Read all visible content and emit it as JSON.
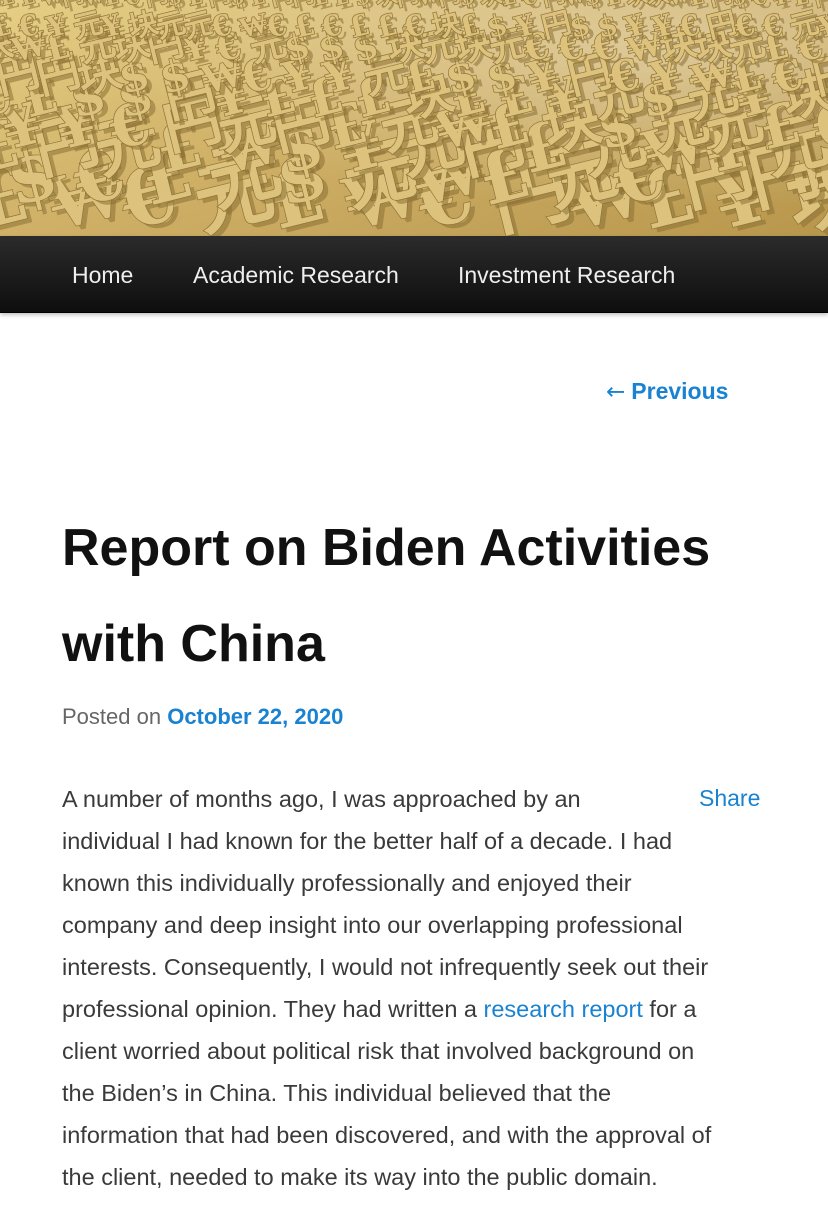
{
  "header": {
    "banner_icon": "currency-symbols-banner",
    "glyphs": [
      "€",
      "元",
      "¥",
      "£",
      "₩",
      "$",
      "块",
      "円"
    ]
  },
  "nav": {
    "items": [
      {
        "label": "Home"
      },
      {
        "label": "Academic Research"
      },
      {
        "label": "Investment Research"
      }
    ]
  },
  "pagination": {
    "previous_arrow": "←",
    "previous_label": "Previous"
  },
  "post": {
    "title_line1": "Report on Biden Activities",
    "title_line2": "with China",
    "posted_on_label": "Posted on",
    "date": "October 22, 2020",
    "share_label": "Share",
    "lines": [
      "A number of months ago, I was approached by an",
      "individual I had known for the better half of a decade. I had",
      "known this individually professionally and enjoyed their",
      "company and deep insight into our overlapping professional",
      "interests. Consequently, I would not infrequently seek out their"
    ],
    "line6_before": "professional opinion. They had written a ",
    "line6_link": "research report",
    "line6_after": " for a",
    "lines_after": [
      "client worried about political risk that involved background on",
      "the Biden’s in China. This individual believed that the",
      "information that had been discovered, and with the approval of",
      "the client, needed to make its way into the public domain."
    ]
  },
  "colors": {
    "link": "#1982d1",
    "nav_bg": "#1a1a1a",
    "banner_gold": "#d4b76c"
  }
}
